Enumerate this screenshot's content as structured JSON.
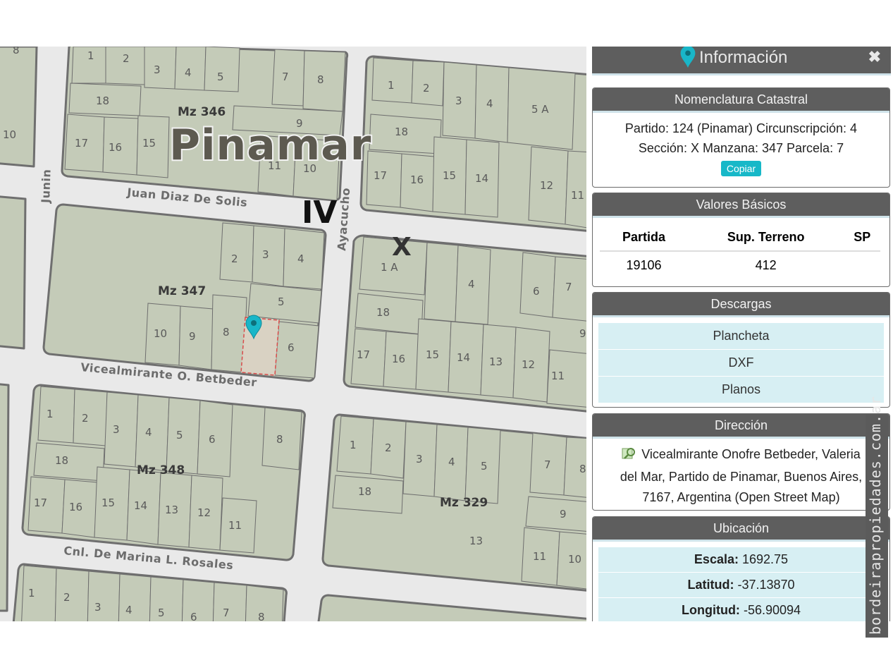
{
  "map": {
    "city_label": "Pinamar",
    "sections": [
      "IV",
      "X"
    ],
    "streets": {
      "juan_diaz": "Juan Diaz De Solis",
      "betbeder": "Vicealmirante O. Betbeder",
      "rosales": "Cnl. De Marina L. Rosales",
      "junin": "Junin",
      "ayacucho": "Ayacucho"
    },
    "manzanas": {
      "m346": "Mz 346",
      "m347": "Mz 347",
      "m348": "Mz 348",
      "m329": "Mz 329"
    },
    "lot_numbers": {
      "b346": [
        "1",
        "2",
        "3",
        "4",
        "5",
        "7",
        "8",
        "18",
        "9",
        "17",
        "16",
        "15",
        "11",
        "10"
      ],
      "bne": [
        "1",
        "2",
        "3",
        "4",
        "5 A",
        "18",
        "17",
        "16",
        "15",
        "14",
        "12",
        "11"
      ],
      "b347": [
        "2",
        "3",
        "4",
        "5",
        "10",
        "9",
        "8",
        "6"
      ],
      "bx": [
        "1 A",
        "4",
        "6",
        "7",
        "18",
        "9",
        "17",
        "16",
        "15",
        "14",
        "13",
        "12",
        "11"
      ],
      "b348": [
        "1",
        "2",
        "3",
        "4",
        "5",
        "6",
        "8",
        "18",
        "17",
        "16",
        "15",
        "14",
        "13",
        "12",
        "11"
      ],
      "b329": [
        "1",
        "2",
        "3",
        "4",
        "5",
        "7",
        "8",
        "18",
        "9",
        "13",
        "11",
        "10"
      ],
      "bsw": [
        "1",
        "2",
        "3",
        "4",
        "5",
        "6",
        "7",
        "8"
      ],
      "bleft": [
        "8",
        "10"
      ]
    },
    "selected_parcel_color": "#d9d2c3",
    "marker_color": "#19b6c8"
  },
  "panel": {
    "title": "Información",
    "close": "✖",
    "nomenclatura": {
      "header": "Nomenclatura Catastral",
      "line1": "Partido: 124 (Pinamar) Circunscripción: 4",
      "line2": "Sección: X Manzana: 347 Parcela: 7",
      "copy_button": "Copiar"
    },
    "valores": {
      "header": "Valores Básicos",
      "columns": [
        "Partida",
        "Sup. Terreno",
        "SP"
      ],
      "row": [
        "19106",
        "412",
        ""
      ]
    },
    "descargas": {
      "header": "Descargas",
      "items": [
        "Plancheta",
        "DXF",
        "Planos"
      ]
    },
    "direccion": {
      "header": "Dirección",
      "line1": "Vicealmirante Onofre Betbeder, Valeria",
      "line2": "del Mar, Partido de Pinamar, Buenos Aires,",
      "line3": "7167, Argentina (Open Street Map)"
    },
    "ubicacion": {
      "header": "Ubicación",
      "escala_label": "Escala:",
      "escala": "1692.75",
      "latitud_label": "Latitud:",
      "latitud": "-37.13870",
      "longitud_label": "Longitud:",
      "longitud": "-56.90094"
    }
  },
  "watermark": "bordeirapropiedades.com.ar"
}
